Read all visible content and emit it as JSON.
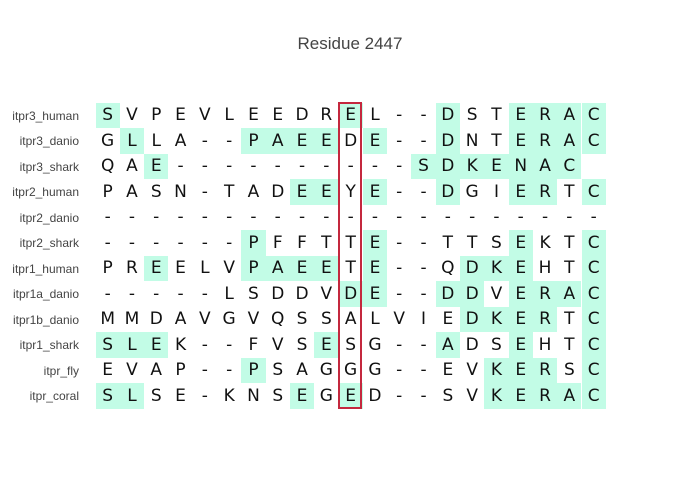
{
  "title": "Residue 2447",
  "highlight_color": "#c2fce6",
  "box_color": "#c4283e",
  "rows": [
    {
      "label": "itpr3_human",
      "seq": "SVPEVLEEDREL--DSTERAC",
      "hl": [
        0,
        10,
        14,
        17,
        18,
        19,
        20
      ]
    },
    {
      "label": "itpr3_danio",
      "seq": "GLLA--PAEEDE--DNTERAC",
      "hl": [
        1,
        6,
        7,
        8,
        9,
        11,
        14,
        17,
        18,
        19,
        20
      ]
    },
    {
      "label": "itpr3_shark",
      "seq": "QAE----------SDKENAC",
      "hl": [
        2,
        13,
        14,
        15,
        16,
        17,
        18,
        19,
        20
      ]
    },
    {
      "label": "itpr2_human",
      "seq": "PASN-TADEEYE--DGIERTC",
      "hl": [
        8,
        9,
        11,
        14,
        17,
        18,
        20
      ]
    },
    {
      "label": "itpr2_danio",
      "seq": "---------------------",
      "hl": []
    },
    {
      "label": "itpr2_shark",
      "seq": "------PFFTTE--TTSEKTC",
      "hl": [
        6,
        11,
        17,
        20
      ]
    },
    {
      "label": "itpr1_human",
      "seq": "PREELVPAEETE--QDKEHTC",
      "hl": [
        2,
        6,
        7,
        8,
        9,
        11,
        15,
        16,
        17,
        20
      ]
    },
    {
      "label": "itpr1a_danio",
      "seq": "-----LSDDVDE--DDVERAC",
      "hl": [
        10,
        11,
        14,
        15,
        17,
        18,
        19,
        20
      ]
    },
    {
      "label": "itpr1b_danio",
      "seq": "MMDAVGVQSSALVIEDKERTC",
      "hl": [
        15,
        16,
        17,
        18,
        20
      ]
    },
    {
      "label": "itpr1_shark",
      "seq": "SLEK--FVSESG--ADSEHTC",
      "hl": [
        0,
        1,
        2,
        9,
        14,
        17,
        20
      ]
    },
    {
      "label": "itpr_fly",
      "seq": "EVAP--PSAGGG--EVKERSC",
      "hl": [
        6,
        16,
        17,
        18,
        20
      ]
    },
    {
      "label": "itpr_coral",
      "seq": "SLSE-KNSEGED--SVKERAC",
      "hl": [
        0,
        1,
        8,
        10,
        16,
        17,
        18,
        19,
        20
      ]
    }
  ],
  "boxed_column_index": 10
}
